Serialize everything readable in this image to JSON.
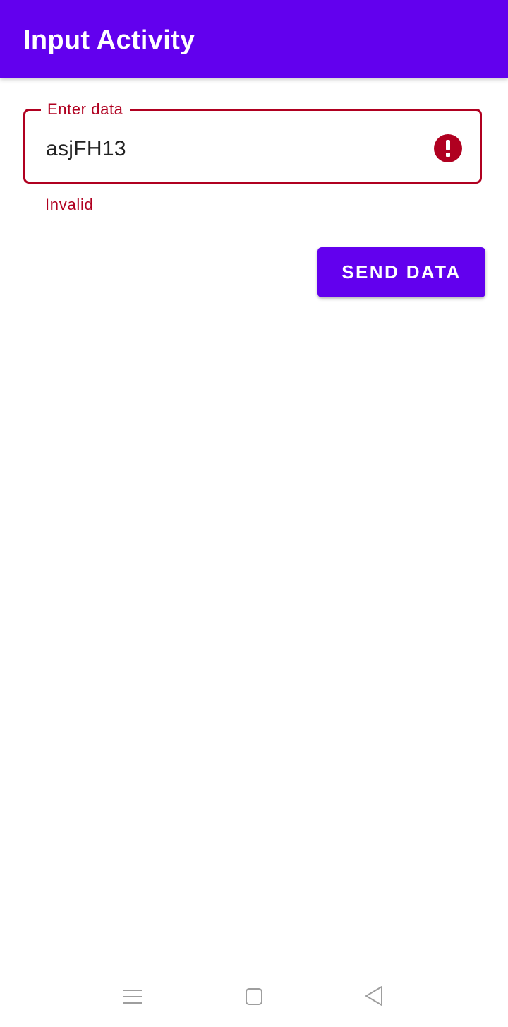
{
  "app_bar": {
    "title": "Input Activity",
    "color": "#6200EE"
  },
  "input_field": {
    "label": "Enter data",
    "value": "asjFH13",
    "helper_text": "Invalid",
    "state": "error",
    "error_color": "#B00020",
    "trailing_icon": "error-icon"
  },
  "actions": {
    "send_label": "SEND DATA"
  },
  "nav_bar": {
    "icons": [
      "menu-icon",
      "home-icon",
      "back-icon"
    ]
  }
}
